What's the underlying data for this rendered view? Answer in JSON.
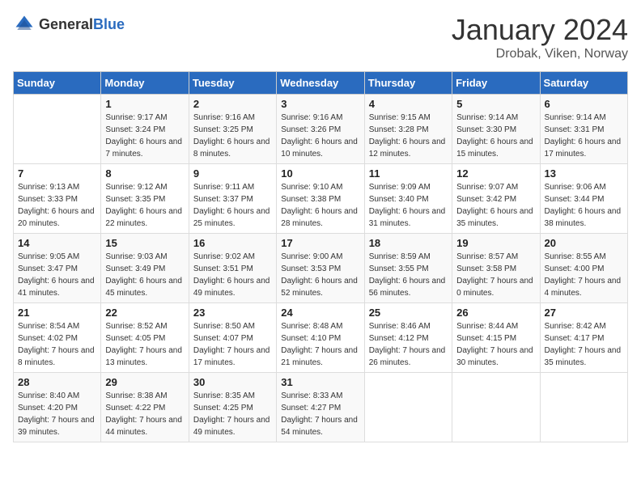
{
  "header": {
    "logo_general": "General",
    "logo_blue": "Blue",
    "month_title": "January 2024",
    "location": "Drobak, Viken, Norway"
  },
  "weekdays": [
    "Sunday",
    "Monday",
    "Tuesday",
    "Wednesday",
    "Thursday",
    "Friday",
    "Saturday"
  ],
  "weeks": [
    [
      {
        "day": "",
        "sunrise": "",
        "sunset": "",
        "daylight": ""
      },
      {
        "day": "1",
        "sunrise": "Sunrise: 9:17 AM",
        "sunset": "Sunset: 3:24 PM",
        "daylight": "Daylight: 6 hours and 7 minutes."
      },
      {
        "day": "2",
        "sunrise": "Sunrise: 9:16 AM",
        "sunset": "Sunset: 3:25 PM",
        "daylight": "Daylight: 6 hours and 8 minutes."
      },
      {
        "day": "3",
        "sunrise": "Sunrise: 9:16 AM",
        "sunset": "Sunset: 3:26 PM",
        "daylight": "Daylight: 6 hours and 10 minutes."
      },
      {
        "day": "4",
        "sunrise": "Sunrise: 9:15 AM",
        "sunset": "Sunset: 3:28 PM",
        "daylight": "Daylight: 6 hours and 12 minutes."
      },
      {
        "day": "5",
        "sunrise": "Sunrise: 9:14 AM",
        "sunset": "Sunset: 3:30 PM",
        "daylight": "Daylight: 6 hours and 15 minutes."
      },
      {
        "day": "6",
        "sunrise": "Sunrise: 9:14 AM",
        "sunset": "Sunset: 3:31 PM",
        "daylight": "Daylight: 6 hours and 17 minutes."
      }
    ],
    [
      {
        "day": "7",
        "sunrise": "Sunrise: 9:13 AM",
        "sunset": "Sunset: 3:33 PM",
        "daylight": "Daylight: 6 hours and 20 minutes."
      },
      {
        "day": "8",
        "sunrise": "Sunrise: 9:12 AM",
        "sunset": "Sunset: 3:35 PM",
        "daylight": "Daylight: 6 hours and 22 minutes."
      },
      {
        "day": "9",
        "sunrise": "Sunrise: 9:11 AM",
        "sunset": "Sunset: 3:37 PM",
        "daylight": "Daylight: 6 hours and 25 minutes."
      },
      {
        "day": "10",
        "sunrise": "Sunrise: 9:10 AM",
        "sunset": "Sunset: 3:38 PM",
        "daylight": "Daylight: 6 hours and 28 minutes."
      },
      {
        "day": "11",
        "sunrise": "Sunrise: 9:09 AM",
        "sunset": "Sunset: 3:40 PM",
        "daylight": "Daylight: 6 hours and 31 minutes."
      },
      {
        "day": "12",
        "sunrise": "Sunrise: 9:07 AM",
        "sunset": "Sunset: 3:42 PM",
        "daylight": "Daylight: 6 hours and 35 minutes."
      },
      {
        "day": "13",
        "sunrise": "Sunrise: 9:06 AM",
        "sunset": "Sunset: 3:44 PM",
        "daylight": "Daylight: 6 hours and 38 minutes."
      }
    ],
    [
      {
        "day": "14",
        "sunrise": "Sunrise: 9:05 AM",
        "sunset": "Sunset: 3:47 PM",
        "daylight": "Daylight: 6 hours and 41 minutes."
      },
      {
        "day": "15",
        "sunrise": "Sunrise: 9:03 AM",
        "sunset": "Sunset: 3:49 PM",
        "daylight": "Daylight: 6 hours and 45 minutes."
      },
      {
        "day": "16",
        "sunrise": "Sunrise: 9:02 AM",
        "sunset": "Sunset: 3:51 PM",
        "daylight": "Daylight: 6 hours and 49 minutes."
      },
      {
        "day": "17",
        "sunrise": "Sunrise: 9:00 AM",
        "sunset": "Sunset: 3:53 PM",
        "daylight": "Daylight: 6 hours and 52 minutes."
      },
      {
        "day": "18",
        "sunrise": "Sunrise: 8:59 AM",
        "sunset": "Sunset: 3:55 PM",
        "daylight": "Daylight: 6 hours and 56 minutes."
      },
      {
        "day": "19",
        "sunrise": "Sunrise: 8:57 AM",
        "sunset": "Sunset: 3:58 PM",
        "daylight": "Daylight: 7 hours and 0 minutes."
      },
      {
        "day": "20",
        "sunrise": "Sunrise: 8:55 AM",
        "sunset": "Sunset: 4:00 PM",
        "daylight": "Daylight: 7 hours and 4 minutes."
      }
    ],
    [
      {
        "day": "21",
        "sunrise": "Sunrise: 8:54 AM",
        "sunset": "Sunset: 4:02 PM",
        "daylight": "Daylight: 7 hours and 8 minutes."
      },
      {
        "day": "22",
        "sunrise": "Sunrise: 8:52 AM",
        "sunset": "Sunset: 4:05 PM",
        "daylight": "Daylight: 7 hours and 13 minutes."
      },
      {
        "day": "23",
        "sunrise": "Sunrise: 8:50 AM",
        "sunset": "Sunset: 4:07 PM",
        "daylight": "Daylight: 7 hours and 17 minutes."
      },
      {
        "day": "24",
        "sunrise": "Sunrise: 8:48 AM",
        "sunset": "Sunset: 4:10 PM",
        "daylight": "Daylight: 7 hours and 21 minutes."
      },
      {
        "day": "25",
        "sunrise": "Sunrise: 8:46 AM",
        "sunset": "Sunset: 4:12 PM",
        "daylight": "Daylight: 7 hours and 26 minutes."
      },
      {
        "day": "26",
        "sunrise": "Sunrise: 8:44 AM",
        "sunset": "Sunset: 4:15 PM",
        "daylight": "Daylight: 7 hours and 30 minutes."
      },
      {
        "day": "27",
        "sunrise": "Sunrise: 8:42 AM",
        "sunset": "Sunset: 4:17 PM",
        "daylight": "Daylight: 7 hours and 35 minutes."
      }
    ],
    [
      {
        "day": "28",
        "sunrise": "Sunrise: 8:40 AM",
        "sunset": "Sunset: 4:20 PM",
        "daylight": "Daylight: 7 hours and 39 minutes."
      },
      {
        "day": "29",
        "sunrise": "Sunrise: 8:38 AM",
        "sunset": "Sunset: 4:22 PM",
        "daylight": "Daylight: 7 hours and 44 minutes."
      },
      {
        "day": "30",
        "sunrise": "Sunrise: 8:35 AM",
        "sunset": "Sunset: 4:25 PM",
        "daylight": "Daylight: 7 hours and 49 minutes."
      },
      {
        "day": "31",
        "sunrise": "Sunrise: 8:33 AM",
        "sunset": "Sunset: 4:27 PM",
        "daylight": "Daylight: 7 hours and 54 minutes."
      },
      {
        "day": "",
        "sunrise": "",
        "sunset": "",
        "daylight": ""
      },
      {
        "day": "",
        "sunrise": "",
        "sunset": "",
        "daylight": ""
      },
      {
        "day": "",
        "sunrise": "",
        "sunset": "",
        "daylight": ""
      }
    ]
  ]
}
